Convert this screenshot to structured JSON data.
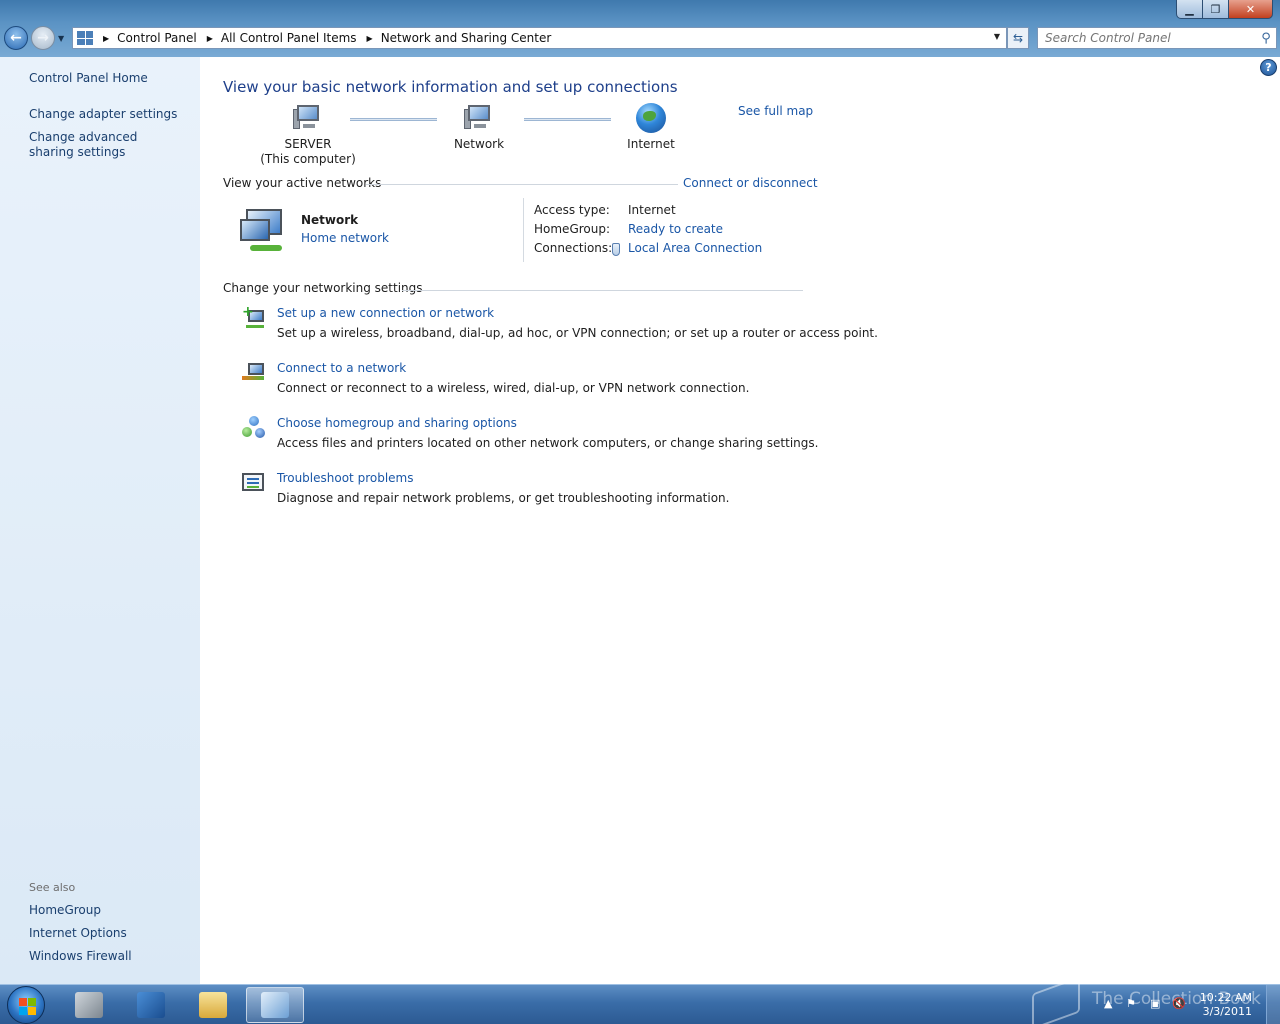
{
  "window": {
    "min_glyph": "▁",
    "max_glyph": "❐",
    "close_glyph": "✕"
  },
  "address": {
    "crumbs": [
      "Control Panel",
      "All Control Panel Items",
      "Network and Sharing Center"
    ]
  },
  "search": {
    "placeholder": "Search Control Panel"
  },
  "left_pane": {
    "home": "Control Panel Home",
    "links": [
      "Change adapter settings",
      "Change advanced sharing settings"
    ],
    "see_also_label": "See also",
    "see_also": [
      "HomeGroup",
      "Internet Options",
      "Windows Firewall"
    ]
  },
  "main": {
    "heading": "View your basic network information and set up connections",
    "see_full_map": "See full map",
    "map": {
      "computer_name": "SERVER",
      "computer_note": "(This computer)",
      "network": "Network",
      "internet": "Internet"
    },
    "active_networks": {
      "label": "View your active networks",
      "connect_link": "Connect or disconnect",
      "network_name": "Network",
      "network_type": "Home network",
      "access_type_label": "Access type:",
      "access_type_value": "Internet",
      "homegroup_label": "HomeGroup:",
      "homegroup_value": "Ready to create",
      "connections_label": "Connections:",
      "connections_value": "Local Area Connection"
    },
    "change_settings_label": "Change your networking settings",
    "tasks": [
      {
        "title": "Set up a new connection or network",
        "desc": "Set up a wireless, broadband, dial-up, ad hoc, or VPN connection; or set up a router or access point."
      },
      {
        "title": "Connect to a network",
        "desc": "Connect or reconnect to a wireless, wired, dial-up, or VPN network connection."
      },
      {
        "title": "Choose homegroup and sharing options",
        "desc": "Access files and printers located on other network computers, or change sharing settings."
      },
      {
        "title": "Troubleshoot problems",
        "desc": "Diagnose and repair network problems, or get troubleshooting information."
      }
    ]
  },
  "taskbar": {
    "watermark": "The Collection Book",
    "time": "10:22 AM",
    "date": "3/3/2011"
  },
  "colors": {
    "link": "#1a56a6",
    "heading": "#1e3f8a",
    "left_pane": "#e9f2fb"
  }
}
